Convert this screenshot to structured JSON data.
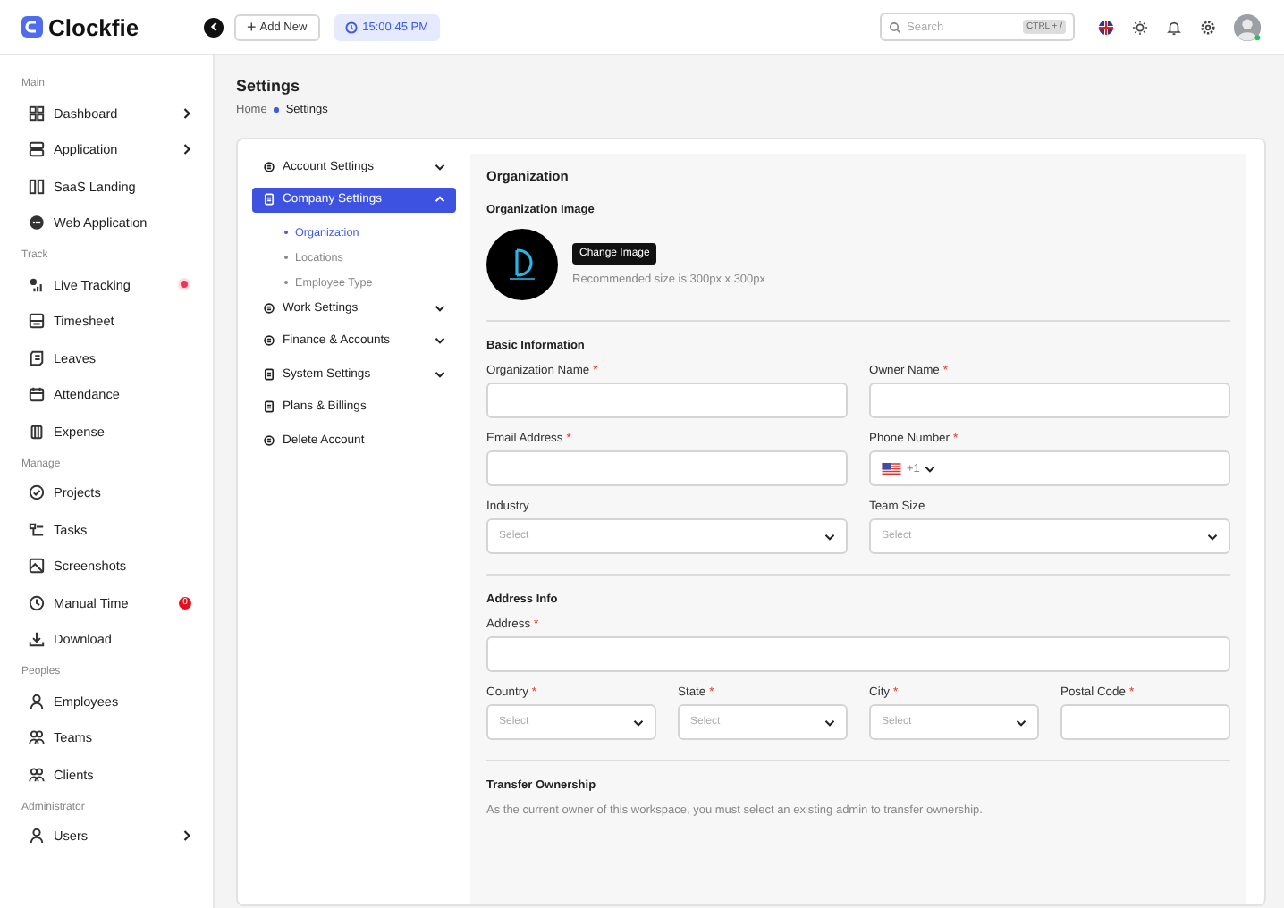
{
  "header": {
    "logo_text": "Clockfie",
    "add_button": {
      "icon": "+",
      "label": "Add New"
    },
    "clock": "15:00:45 PM",
    "search": {
      "placeholder": "Search",
      "shortcut": "CTRL + /"
    }
  },
  "sidebar": {
    "sections": [
      {
        "title": "Main",
        "items": [
          {
            "label": "Dashboard",
            "submenu": true
          },
          {
            "label": "Application",
            "submenu": true
          },
          {
            "label": "SaaS Landing",
            "submenu": false
          },
          {
            "label": "Web Application",
            "submenu": false
          }
        ]
      },
      {
        "title": "Track",
        "items": [
          {
            "label": "Live Tracking",
            "submenu": false,
            "indicator": {
              "kind": "dot"
            }
          },
          {
            "label": "Timesheet",
            "submenu": false
          },
          {
            "label": "Leaves",
            "submenu": false
          },
          {
            "label": "Attendance",
            "submenu": false
          },
          {
            "label": "Expense",
            "submenu": false
          }
        ]
      },
      {
        "title": "Manage",
        "items": [
          {
            "label": "Projects",
            "submenu": false
          },
          {
            "label": "Tasks",
            "submenu": false
          },
          {
            "label": "Screenshots",
            "submenu": false
          },
          {
            "label": "Manual Time",
            "submenu": false,
            "indicator": {
              "kind": "count",
              "text": "0"
            }
          },
          {
            "label": "Download",
            "submenu": false
          }
        ]
      },
      {
        "title": "Peoples",
        "items": [
          {
            "label": "Employees",
            "submenu": false
          },
          {
            "label": "Teams",
            "submenu": false
          },
          {
            "label": "Clients",
            "submenu": false
          }
        ]
      },
      {
        "title": "Administrator",
        "items": [
          {
            "label": "Users",
            "submenu": true
          }
        ]
      }
    ]
  },
  "page": {
    "title": "Settings",
    "breadcrumb": [
      "Home",
      "Settings"
    ]
  },
  "settings_menu": [
    {
      "label": "Account Settings",
      "expandable": true,
      "expanded": false,
      "selected": false
    },
    {
      "label": "Company Settings",
      "expandable": true,
      "expanded": true,
      "selected": true,
      "children": [
        {
          "label": "Organization",
          "selected": true
        },
        {
          "label": "Locations",
          "selected": false
        },
        {
          "label": "Employee Type",
          "selected": false
        }
      ]
    },
    {
      "label": "Work Settings",
      "expandable": true,
      "expanded": false,
      "selected": false
    },
    {
      "label": "Finance & Accounts",
      "expandable": true,
      "expanded": false,
      "selected": false
    },
    {
      "label": "System Settings",
      "expandable": true,
      "expanded": false,
      "selected": false
    },
    {
      "label": "Plans & Billings",
      "expandable": false,
      "selected": false
    },
    {
      "label": "Delete Account",
      "expandable": false,
      "selected": false
    }
  ],
  "form": {
    "title": "Organization",
    "image": {
      "heading": "Organization Image",
      "button": "Change Image",
      "hint": "Recommended size is 300px x 300px"
    },
    "sections": [
      {
        "heading": "Basic Information",
        "fields": [
          {
            "label": "Organization Name",
            "required_mark": "*",
            "kind": "text"
          },
          {
            "label": "Owner Name",
            "required_mark": "*",
            "kind": "text"
          },
          {
            "label": "Email Address",
            "required_mark": "*",
            "kind": "text"
          },
          {
            "label": "Phone Number",
            "required_mark": "*",
            "kind": "phone",
            "code": "+1"
          },
          {
            "label": "Industry",
            "kind": "select",
            "placeholder": "Select"
          },
          {
            "label": "Team Size",
            "kind": "select",
            "placeholder": "Select"
          }
        ]
      },
      {
        "heading": "Address Info",
        "fields": [
          {
            "label": "Address",
            "required_mark": "*",
            "kind": "text",
            "wide": true
          },
          {
            "label": "Country",
            "required_mark": "*",
            "kind": "select",
            "placeholder": "Select"
          },
          {
            "label": "State",
            "required_mark": "*",
            "kind": "select",
            "placeholder": "Select"
          },
          {
            "label": "City",
            "required_mark": "*",
            "kind": "select",
            "placeholder": "Select"
          },
          {
            "label": "Postal Code",
            "required_mark": "*",
            "kind": "text"
          }
        ]
      }
    ],
    "transfer": {
      "heading": "Transfer Ownership",
      "text": "As the current owner of this workspace, you must select an existing admin to transfer ownership."
    }
  }
}
